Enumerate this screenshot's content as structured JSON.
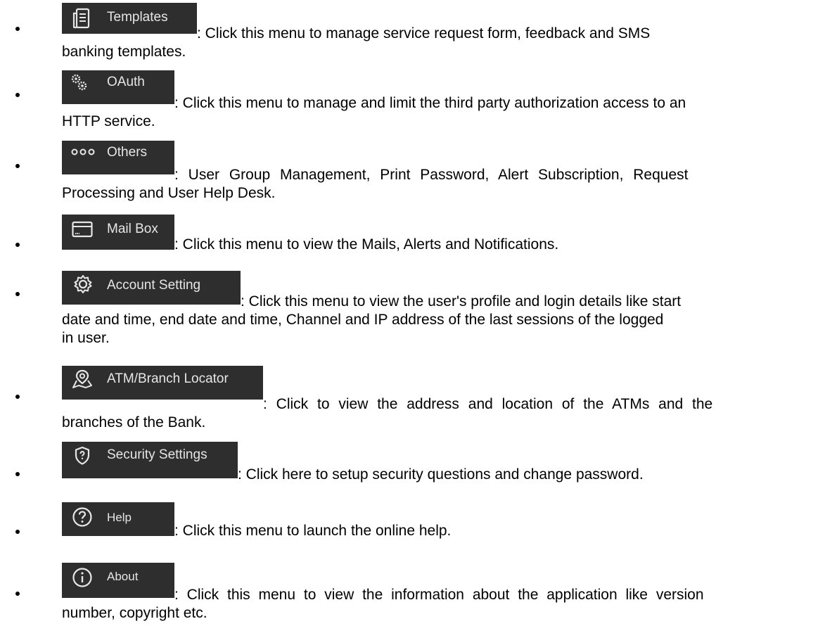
{
  "items": [
    {
      "label": "Templates",
      "icon": "document-list-icon",
      "line1": ": Click this menu to manage service request form, feedback and SMS",
      "line2": "banking templates.",
      "line3": ""
    },
    {
      "label": "OAuth",
      "icon": "gears-icon",
      "line1": ": Click this menu to manage and limit the third party authorization access to an",
      "line2": "HTTP service.",
      "line3": ""
    },
    {
      "label": "Others",
      "icon": "three-dots-icon",
      "line1": ": User Group Management, Print Password, Alert Subscription, Request",
      "line2": "Processing and User Help Desk.",
      "line3": ""
    },
    {
      "label": "Mail Box",
      "icon": "mailbox-icon",
      "line1": ": Click this menu to view the Mails, Alerts and Notifications.",
      "line2": "",
      "line3": ""
    },
    {
      "label": "Account Setting",
      "icon": "gear-icon",
      "line1": ": Click this menu to view the user's profile and  login details like start",
      "line2": "date and time, end date and time, Channel and IP address of the last sessions of the  logged",
      "line3": "in user."
    },
    {
      "label": "ATM/Branch Locator",
      "icon": "map-pin-icon",
      "line1": ": Click to view the address and location of the ATMs and the",
      "line2": "branches of the Bank.",
      "line3": ""
    },
    {
      "label": "Security Settings",
      "icon": "shield-question-icon",
      "line1": ": Click here to setup security questions and change password.",
      "line2": "",
      "line3": ""
    },
    {
      "label": "Help",
      "icon": "question-circle-icon",
      "line1": ": Click this menu to launch the online help.",
      "line2": "",
      "line3": ""
    },
    {
      "label": "About",
      "icon": "info-circle-icon",
      "line1": ": Click this menu to view the information about the application like version",
      "line2": "number, copyright etc.",
      "line3": ""
    }
  ]
}
